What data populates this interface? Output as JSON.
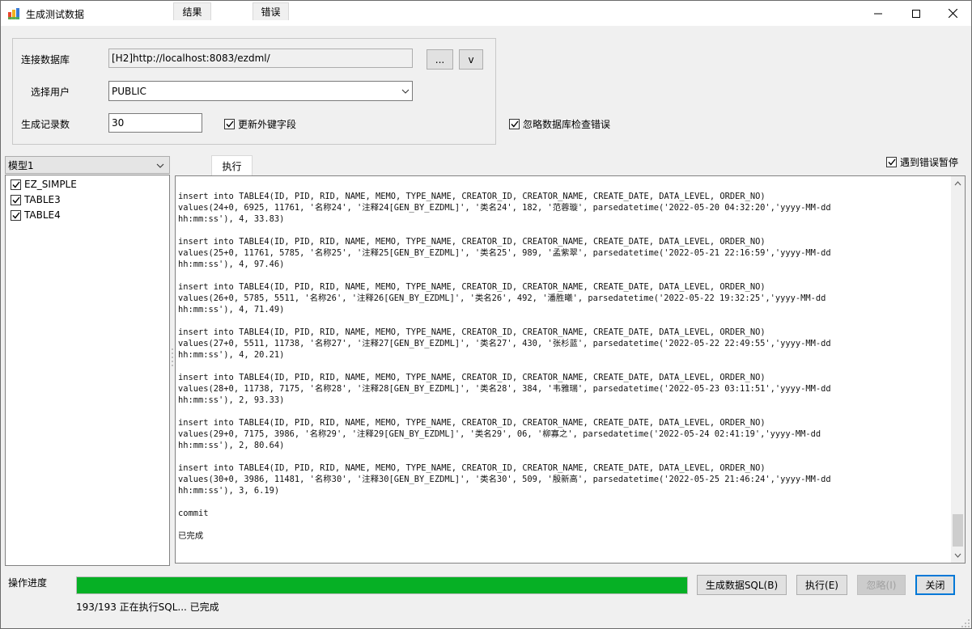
{
  "window": {
    "title": "生成测试数据"
  },
  "form": {
    "db_label": "连接数据库",
    "db_value": "[H2]http://localhost:8083/ezdml/",
    "browse_button": "...",
    "version_button": "v",
    "user_label": "选择用户",
    "user_value": "PUBLIC",
    "count_label": "生成记录数",
    "count_value": "30",
    "update_fk_label": "更新外键字段",
    "update_fk_checked": true,
    "ignore_db_errors_label": "忽略数据库检查错误",
    "ignore_db_errors_checked": true
  },
  "left_panel": {
    "model_value": "模型1",
    "tables": [
      {
        "name": "EZ_SIMPLE",
        "checked": true
      },
      {
        "name": "TABLE3",
        "checked": true
      },
      {
        "name": "TABLE4",
        "checked": true
      }
    ]
  },
  "tabs": [
    {
      "label": "结果",
      "active": false
    },
    {
      "label": "执行",
      "active": true
    },
    {
      "label": "错误",
      "active": false
    }
  ],
  "pause_on_error": {
    "label": "遇到错误暂停",
    "checked": true
  },
  "output": {
    "statements": [
      {
        "line1": "insert into TABLE4(ID, PID, RID, NAME, MEMO, TYPE_NAME, CREATOR_ID, CREATOR_NAME, CREATE_DATE, DATA_LEVEL, ORDER_NO)",
        "line2": "values(24+0, 6925, 11761, '名称24', '注释24[GEN_BY_EZDML]', '类名24', 182, '范蓉璇', parsedatetime('2022-05-20 04:32:20','yyyy-MM-dd",
        "line3": "hh:mm:ss'), 4, 33.83)"
      },
      {
        "line1": "insert into TABLE4(ID, PID, RID, NAME, MEMO, TYPE_NAME, CREATOR_ID, CREATOR_NAME, CREATE_DATE, DATA_LEVEL, ORDER_NO)",
        "line2": "values(25+0, 11761, 5785, '名称25', '注释25[GEN_BY_EZDML]', '类名25', 989, '孟紫翠', parsedatetime('2022-05-21 22:16:59','yyyy-MM-dd",
        "line3": "hh:mm:ss'), 4, 97.46)"
      },
      {
        "line1": "insert into TABLE4(ID, PID, RID, NAME, MEMO, TYPE_NAME, CREATOR_ID, CREATOR_NAME, CREATE_DATE, DATA_LEVEL, ORDER_NO)",
        "line2": "values(26+0, 5785, 5511, '名称26', '注释26[GEN_BY_EZDML]', '类名26', 492, '潘胜曦', parsedatetime('2022-05-22 19:32:25','yyyy-MM-dd",
        "line3": "hh:mm:ss'), 4, 71.49)"
      },
      {
        "line1": "insert into TABLE4(ID, PID, RID, NAME, MEMO, TYPE_NAME, CREATOR_ID, CREATOR_NAME, CREATE_DATE, DATA_LEVEL, ORDER_NO)",
        "line2": "values(27+0, 5511, 11738, '名称27', '注释27[GEN_BY_EZDML]', '类名27', 430, '张杉蓝', parsedatetime('2022-05-22 22:49:55','yyyy-MM-dd",
        "line3": "hh:mm:ss'), 4, 20.21)"
      },
      {
        "line1": "insert into TABLE4(ID, PID, RID, NAME, MEMO, TYPE_NAME, CREATOR_ID, CREATOR_NAME, CREATE_DATE, DATA_LEVEL, ORDER_NO)",
        "line2": "values(28+0, 11738, 7175, '名称28', '注释28[GEN_BY_EZDML]', '类名28', 384, '韦雅瑞', parsedatetime('2022-05-23 03:11:51','yyyy-MM-dd",
        "line3": "hh:mm:ss'), 2, 93.33)"
      },
      {
        "line1": "insert into TABLE4(ID, PID, RID, NAME, MEMO, TYPE_NAME, CREATOR_ID, CREATOR_NAME, CREATE_DATE, DATA_LEVEL, ORDER_NO)",
        "line2": "values(29+0, 7175, 3986, '名称29', '注释29[GEN_BY_EZDML]', '类名29', 06, '柳寡之', parsedatetime('2022-05-24 02:41:19','yyyy-MM-dd",
        "line3": "hh:mm:ss'), 2, 80.64)"
      },
      {
        "line1": "insert into TABLE4(ID, PID, RID, NAME, MEMO, TYPE_NAME, CREATOR_ID, CREATOR_NAME, CREATE_DATE, DATA_LEVEL, ORDER_NO)",
        "line2": "values(30+0, 3986, 11481, '名称30', '注释30[GEN_BY_EZDML]', '类名30', 509, '殷新高', parsedatetime('2022-05-25 21:46:24','yyyy-MM-dd",
        "line3": "hh:mm:ss'), 3, 6.19)"
      }
    ],
    "commit": "commit",
    "done": "已完成"
  },
  "progress": {
    "label": "操作进度",
    "fraction": 1.0,
    "status": "193/193 正在执行SQL... 已完成",
    "color": "#06b025"
  },
  "buttons": {
    "generate_sql": "生成数据SQL(B)",
    "execute": "执行(E)",
    "ignore": "忽略(I)",
    "close": "关闭"
  }
}
